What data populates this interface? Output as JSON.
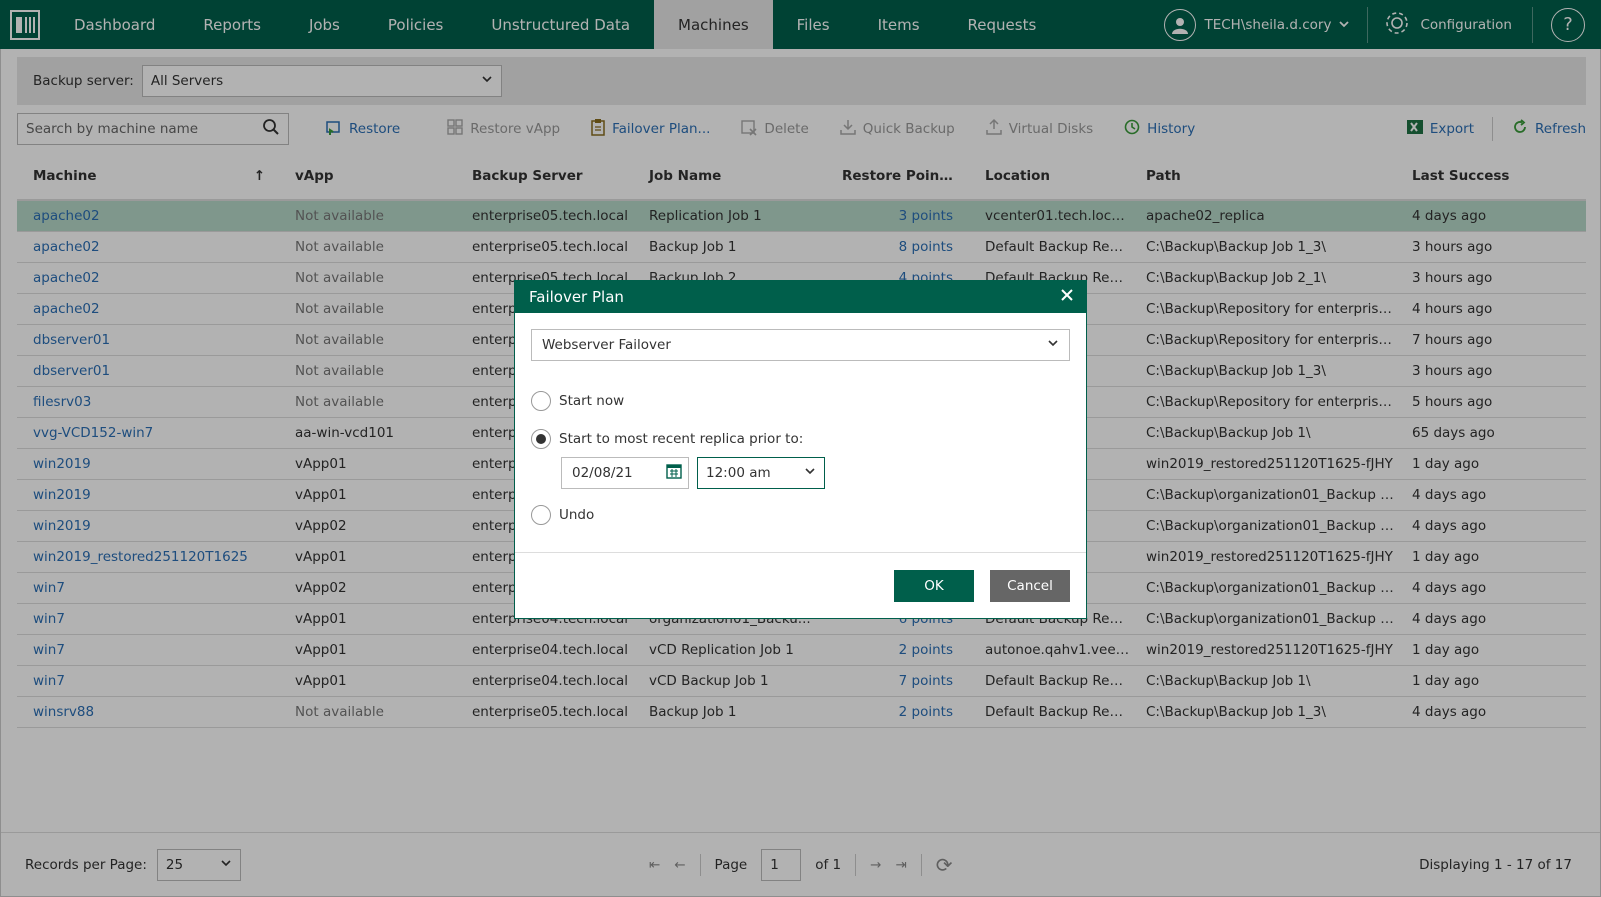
{
  "nav": {
    "tabs": [
      "Dashboard",
      "Reports",
      "Jobs",
      "Policies",
      "Unstructured Data",
      "Machines",
      "Files",
      "Items",
      "Requests"
    ],
    "active_tab": "Machines",
    "user": "TECH\\sheila.d.cory",
    "config": "Configuration",
    "help": "?"
  },
  "server_bar": {
    "label": "Backup server:",
    "value": "All Servers"
  },
  "toolbar": {
    "search_placeholder": "Search by machine name",
    "restore": "Restore",
    "restore_vapp": "Restore vApp",
    "failover_plan": "Failover Plan...",
    "delete": "Delete",
    "quick_backup": "Quick Backup",
    "virtual_disks": "Virtual Disks",
    "history": "History",
    "export": "Export",
    "refresh": "Refresh"
  },
  "grid": {
    "headers": [
      "Machine",
      "vApp",
      "Backup Server",
      "Job Name",
      "Restore Points",
      "Location",
      "Path",
      "Last Success"
    ],
    "sort_icon": "↑",
    "rows": [
      [
        "apache02",
        "Not available",
        "enterprise05.tech.local",
        "Replication Job 1",
        "3 points",
        "vcenter01.tech.local\\e...",
        "apache02_replica",
        "4 days ago"
      ],
      [
        "apache02",
        "Not available",
        "enterprise05.tech.local",
        "Backup Job 1",
        "8 points",
        "Default Backup Repos...",
        "C:\\Backup\\Backup Job 1_3\\",
        "3 hours ago"
      ],
      [
        "apache02",
        "Not available",
        "enterprise05.tech.local",
        "Backup Job 2",
        "4 points",
        "Default Backup Repos...",
        "C:\\Backup\\Backup Job 2_1\\",
        "3 hours ago"
      ],
      [
        "apache02",
        "Not available",
        "enterp",
        "",
        "",
        "y 5",
        "C:\\Backup\\Repository for enterprise...",
        "4 hours ago"
      ],
      [
        "dbserver01",
        "Not available",
        "enterp",
        "",
        "",
        "y 5",
        "C:\\Backup\\Repository for enterprise...",
        "7 hours ago"
      ],
      [
        "dbserver01",
        "Not available",
        "enterp",
        "",
        "",
        "epos...",
        "C:\\Backup\\Backup Job 1_3\\",
        "3 hours ago"
      ],
      [
        "filesrv03",
        "Not available",
        "enterp",
        "",
        "",
        "y 5",
        "C:\\Backup\\Repository for enterprise...",
        "5 hours ago"
      ],
      [
        "vvg-VCD152-win7",
        "aa-win-vcd101",
        "enterp",
        "",
        "",
        "epos...",
        "C:\\Backup\\Backup Job 1\\",
        "65 days ago"
      ],
      [
        "win2019",
        "vApp01",
        "enterp",
        "",
        "",
        "eea...",
        "win2019_restored251120T1625-fJHY",
        "1 day ago"
      ],
      [
        "win2019",
        "vApp01",
        "enterp",
        "",
        "",
        "epos...",
        "C:\\Backup\\organization01_Backup Jo...",
        "4 days ago"
      ],
      [
        "win2019",
        "vApp02",
        "enterp",
        "",
        "",
        "epos...",
        "C:\\Backup\\organization01_Backup Jo...",
        "4 days ago"
      ],
      [
        "win2019_restored251120T1625",
        "vApp01",
        "enterp",
        "",
        "",
        "eea...",
        "win2019_restored251120T1625-fJHY",
        "1 day ago"
      ],
      [
        "win7",
        "vApp02",
        "enterp",
        "",
        "",
        "epos...",
        "C:\\Backup\\organization01_Backup Jo...",
        "4 days ago"
      ],
      [
        "win7",
        "vApp01",
        "enterprise04.tech.local",
        "organization01_Backu...",
        "6 points",
        "Default Backup Repos...",
        "C:\\Backup\\organization01_Backup Jo...",
        "4 days ago"
      ],
      [
        "win7",
        "vApp01",
        "enterprise04.tech.local",
        "vCD Replication Job 1",
        "2 points",
        "autonoe.qahv1.veea...",
        "win2019_restored251120T1625-fJHY",
        "1 day ago"
      ],
      [
        "win7",
        "vApp01",
        "enterprise04.tech.local",
        "vCD Backup Job 1",
        "7 points",
        "Default Backup Repos...",
        "C:\\Backup\\Backup Job 1\\",
        "1 day ago"
      ],
      [
        "winsrv88",
        "Not available",
        "enterprise05.tech.local",
        "Backup Job 1",
        "2 points",
        "Default Backup Repos...",
        "C:\\Backup\\Backup Job 1_3\\",
        "4 days ago"
      ]
    ]
  },
  "footer": {
    "records_label": "Records per Page:",
    "records_value": "25",
    "page_label": "Page",
    "page_value": "1",
    "of_label": "of 1",
    "displaying": "Displaying 1 - 17 of 17"
  },
  "dialog": {
    "title": "Failover Plan",
    "plan_value": "Webserver Failover",
    "option_start_now": "Start now",
    "option_recent": "Start to most recent replica prior to:",
    "date_value": "02/08/21",
    "time_value": "12:00 am",
    "option_undo": "Undo",
    "ok": "OK",
    "cancel": "Cancel"
  },
  "colors": {
    "brand": "#005f4b",
    "link": "#2b6fb5",
    "selected_row": "#b7d8c9"
  }
}
